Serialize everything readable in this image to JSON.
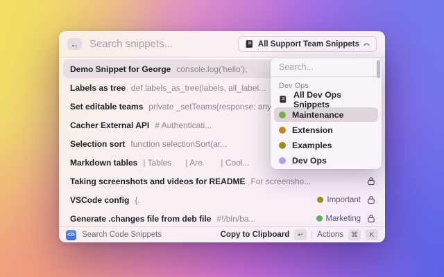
{
  "header": {
    "back_icon": "←",
    "search_placeholder": "Search snippets...",
    "collection_dropdown_label": "All Support Team Snippets"
  },
  "list": {
    "rows": [
      {
        "title": "Demo Snippet for George",
        "preview": "console.log('hello');"
      },
      {
        "title": "Labels as tree",
        "preview": "def labels_as_tree(labels, all_label..."
      },
      {
        "title": "Set editable teams",
        "preview": "private _setTeams(response: any..."
      },
      {
        "title": "Cacher External API",
        "preview": "# Authenticati..."
      },
      {
        "title": "Selection sort",
        "preview": "function selectionSort(ar..."
      },
      {
        "title": "Markdown tables",
        "preview": "| Tables      | Are        | Cool..."
      },
      {
        "title": "Taking screenshots and videos for README",
        "preview": "For screensho..."
      },
      {
        "title": "VSCode config",
        "preview": "{.",
        "label": "Important",
        "label_color": "#9c8c1e"
      },
      {
        "title": "Generate .changes file from deb file",
        "preview": "#!/bin/ba...",
        "label": "Marketing",
        "label_color": "#5fae63"
      }
    ]
  },
  "popover": {
    "search_placeholder": "Search...",
    "section": "Dev Ops",
    "items": [
      {
        "label": "All Dev Ops Snippets"
      },
      {
        "label": "Maintenance",
        "dot": "#7aac49"
      },
      {
        "label": "Extension",
        "dot": "#c5831f"
      },
      {
        "label": "Examples",
        "dot": "#9c8c1e"
      },
      {
        "label": "Dev Ops",
        "dot": "#b79df2"
      }
    ]
  },
  "footer": {
    "app_icon_glyph": "</>",
    "app_label": "Search Code Snippets",
    "primary_action": "Copy to Clipboard",
    "primary_key": "↵",
    "secondary_action": "Actions",
    "key_cmd": "⌘",
    "key_k": "K"
  }
}
